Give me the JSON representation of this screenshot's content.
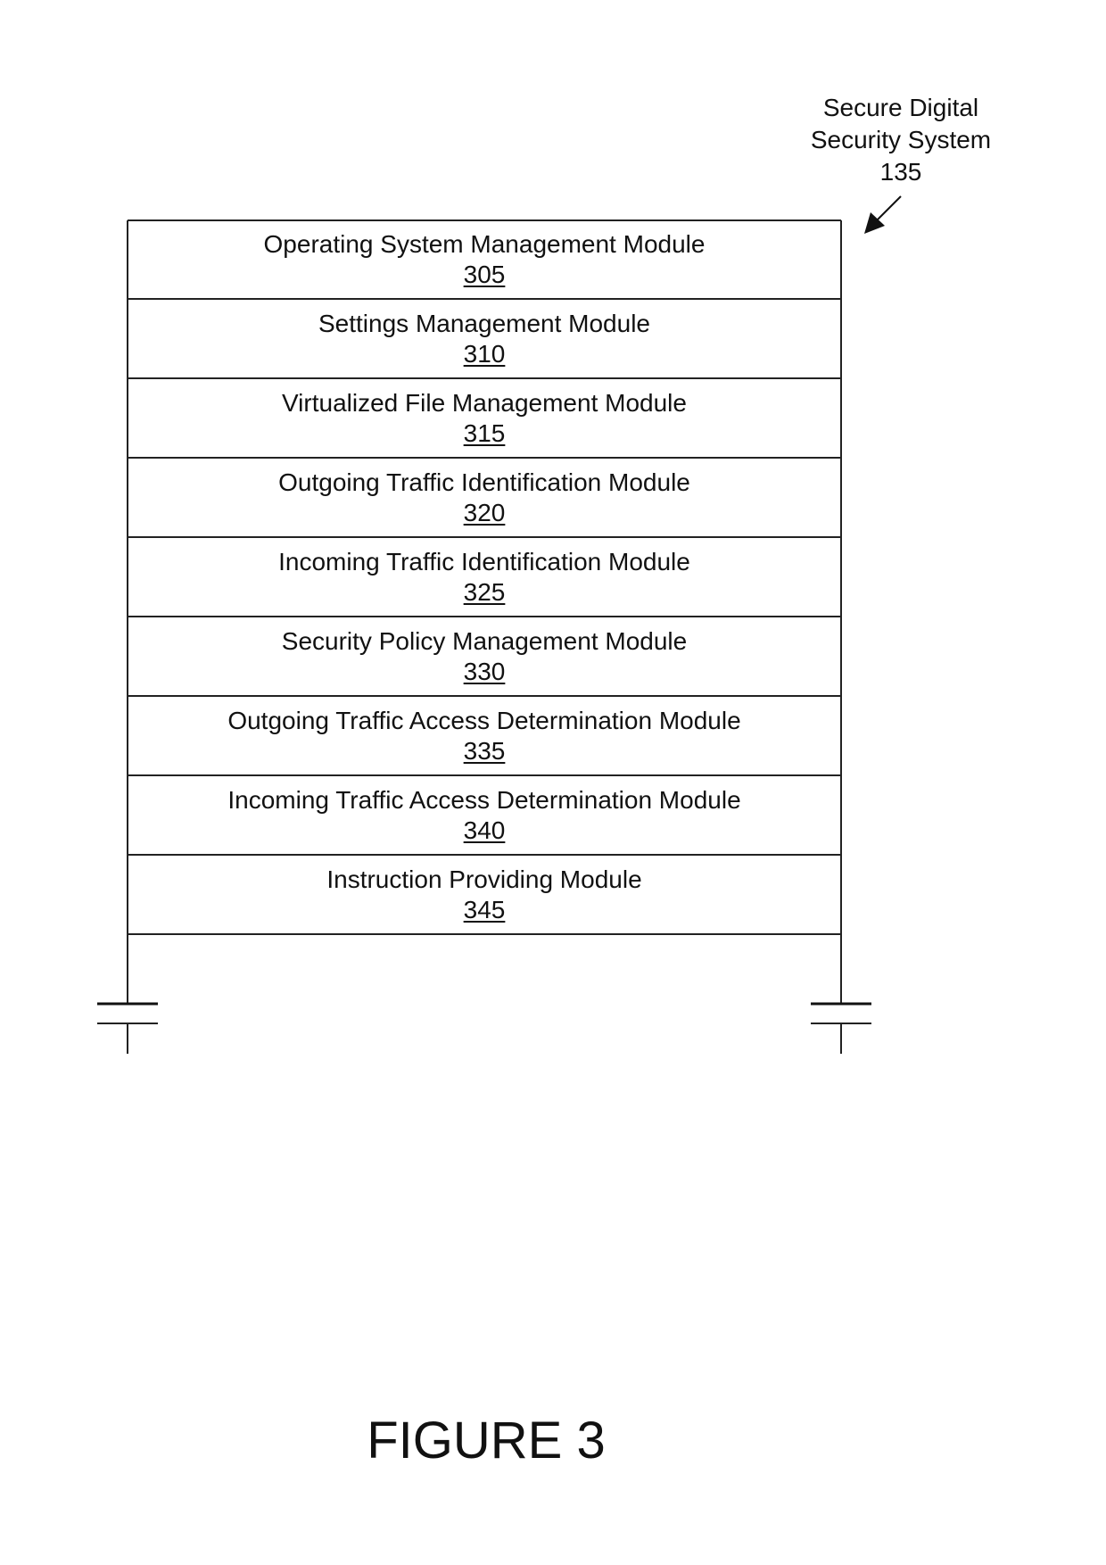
{
  "system": {
    "name_line1": "Secure Digital",
    "name_line2": "Security System",
    "ref": "135"
  },
  "modules": [
    {
      "name": "Operating System Management Module",
      "ref": "305"
    },
    {
      "name": "Settings Management Module",
      "ref": "310"
    },
    {
      "name": "Virtualized File Management Module",
      "ref": "315"
    },
    {
      "name": "Outgoing Traffic Identification Module",
      "ref": "320"
    },
    {
      "name": "Incoming Traffic Identification Module",
      "ref": "325"
    },
    {
      "name": "Security Policy Management Module",
      "ref": "330"
    },
    {
      "name": "Outgoing Traffic Access Determination Module",
      "ref": "335"
    },
    {
      "name": "Incoming Traffic Access Determination Module",
      "ref": "340"
    },
    {
      "name": "Instruction Providing Module",
      "ref": "345"
    }
  ],
  "figure": {
    "title": "FIGURE 3"
  }
}
